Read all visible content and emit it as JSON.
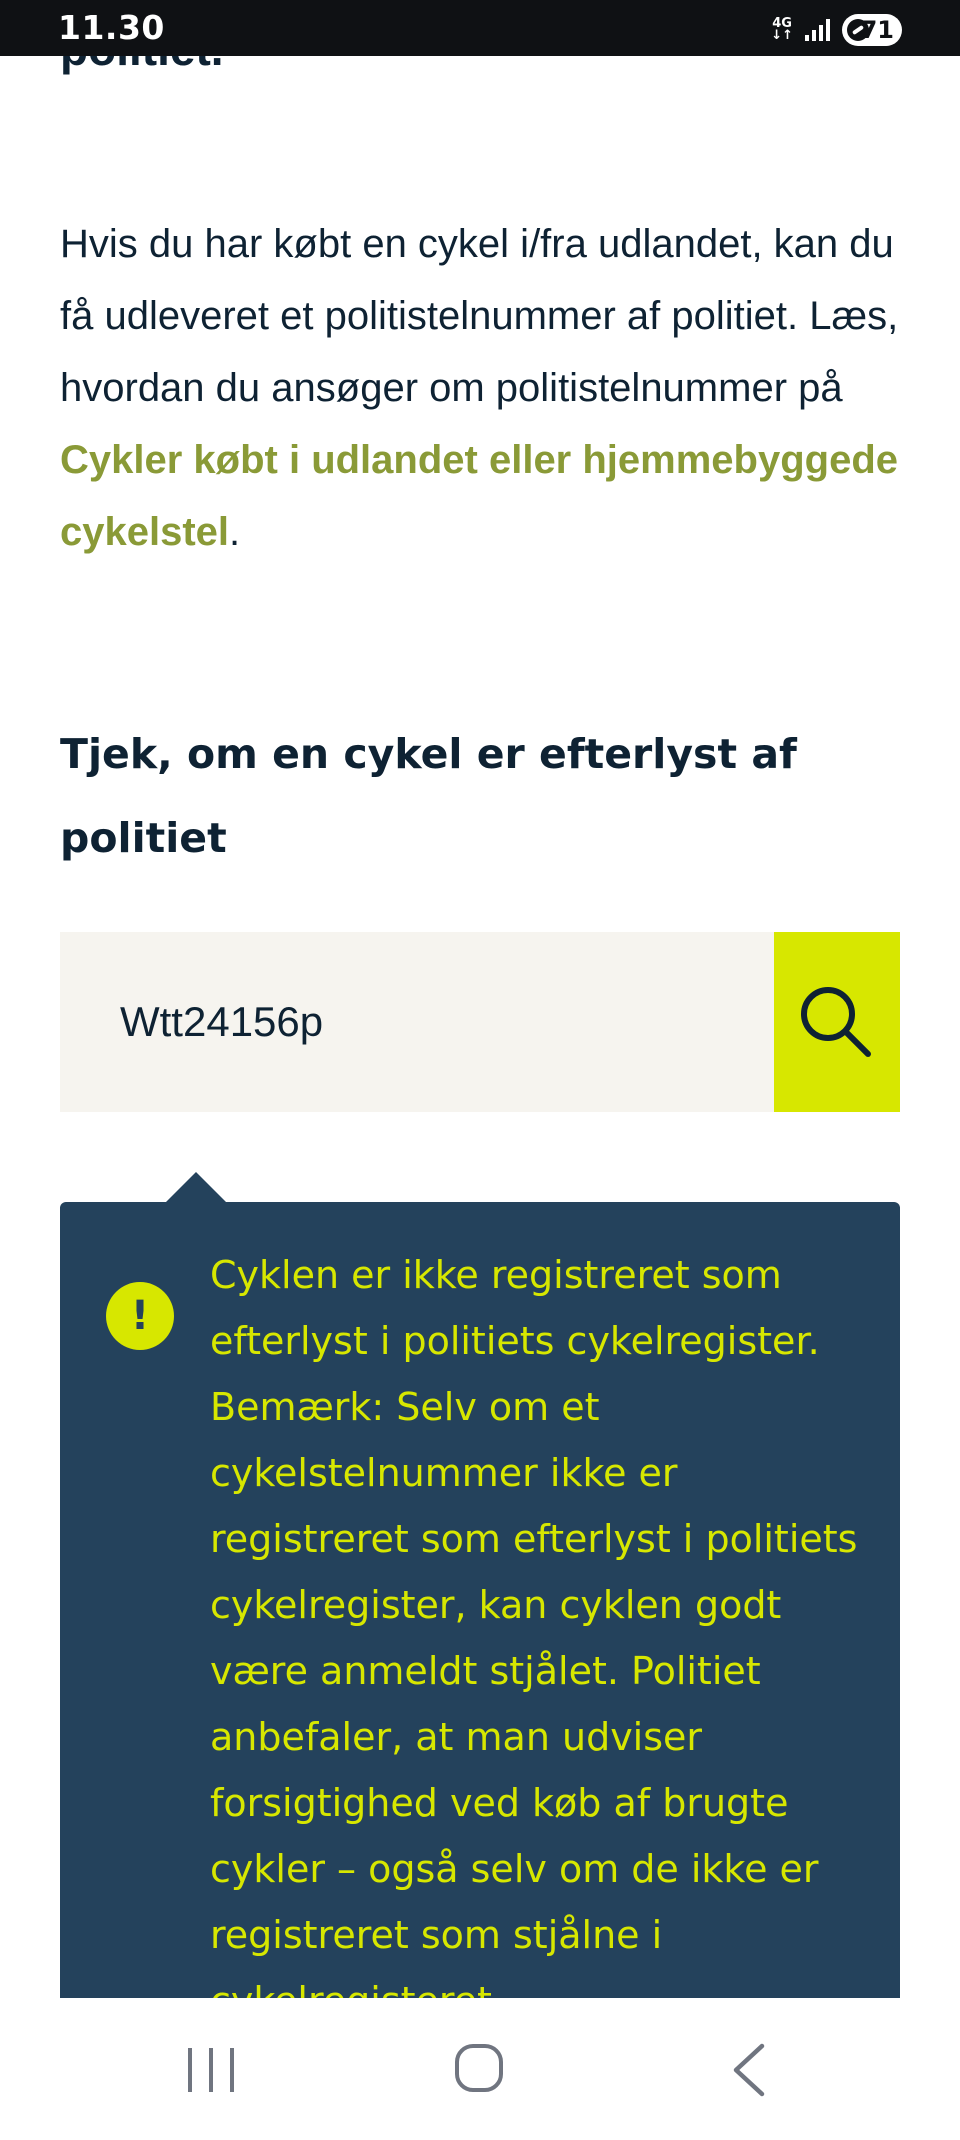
{
  "status_bar": {
    "time": "11.30",
    "network": "4G",
    "battery": "71"
  },
  "page": {
    "cut_heading": "politiet.",
    "intro_text_before_link": "Hvis du har købt en cykel i/fra udlandet, kan du få udleveret et politistelnummer af politiet. Læs, hvordan du ansøger om politistelnummer på ",
    "intro_link": "Cykler købt i udlandet eller hjemmebyggede cykelstel",
    "intro_text_after_link": ".",
    "section_heading": "Tjek, om en cykel er efterlyst af politiet"
  },
  "search": {
    "value": "Wtt24156p",
    "icon": "search-icon"
  },
  "result": {
    "icon_glyph": "!",
    "message": "Cyklen er ikke registreret som efterlyst i politiets cykelregister. Bemærk: Selv om et cykelstelnummer ikke er registreret som efterlyst i politiets cykelregister, kan cyklen godt være anmeldt stjålet. Politiet anbefaler, at man udviser forsigtighed ved køb af brugte cykler – også selv om de ikke er registreret som stjålne i cykelregisteret."
  },
  "colors": {
    "accent_lime": "#d7e700",
    "link_olive": "#8a9a37",
    "panel_navy": "#24425c",
    "text_dark": "#0e2233",
    "input_bg": "#f6f4ef"
  },
  "navigation": {
    "icons": [
      "recent-apps-icon",
      "home-icon",
      "back-icon"
    ]
  }
}
